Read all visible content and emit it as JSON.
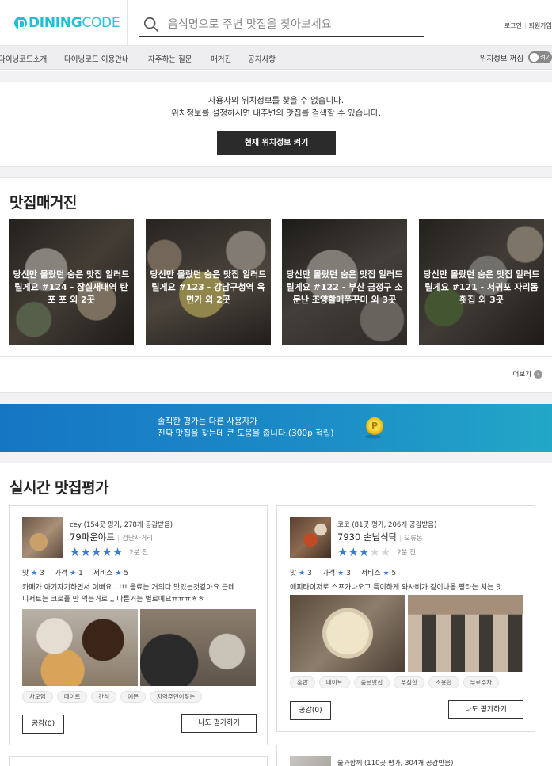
{
  "header": {
    "logo_main": "DINING",
    "logo_thin": "CODE",
    "search_placeholder": "음식명으로 주변 맛집을 찾아보세요",
    "login": "로그인",
    "signup": "회원가입"
  },
  "nav": {
    "items": [
      "다이닝코드소개",
      "다이닝코드 이용안내",
      "자주하는 질문",
      "매거진",
      "공지사항"
    ],
    "location_label": "위치정보 꺼짐",
    "toggle_label": "켜기"
  },
  "location": {
    "line1": "사용자의 위치정보를 찾을 수 없습니다.",
    "line2": "위치정보를 설정하시면 내주변의 맛집를 검색할 수 있습니다.",
    "button": "현재 위치정보 켜기"
  },
  "magazine": {
    "title": "맛집매거진",
    "cards": [
      {
        "title": "당신만 몰랐던 숨은 맛집 알러드릴게요 #124 - 잠실새내역 탄포 포 외 2곳"
      },
      {
        "title": "당신만 몰랐던 숨은 맛집 알러드릴게요 #123 - 강남구청역 옥면가 외 2곳"
      },
      {
        "title": "당신만 몰랐던 숨은 맛집 알러드릴게요 #122 - 부산 금정구 소문난 조양할매쭈꾸미 외 3곳"
      },
      {
        "title": "당신만 몰랐던 숨은 맛집 알러드릴게요 #121 - 서귀포 자리돔횟집 외 3곳"
      }
    ],
    "more": "더보기"
  },
  "banner": {
    "line1": "솔직한 평가는 다른 사용자가",
    "line2": "진짜 맛집을 찾는데 큰 도움을 줍니다.(300p 적립)",
    "coin_letter": "P"
  },
  "reviews": {
    "title": "실시간 맛집평가",
    "items": [
      {
        "user": "cey (154곳 평가, 278개 공감받음)",
        "place": "79파운야드",
        "area": "검단사거리",
        "rating": 5,
        "time": "2분 전",
        "scores": {
          "taste": "맛",
          "taste_v": "3",
          "price": "가격",
          "price_v": "1",
          "service": "서비스",
          "service_v": "5"
        },
        "text1": "카페가 아기자기하면서 이뻐요...!!! 음료는 거의다 맛있는것같아요 근데",
        "text2": "디저트는 크로플 만 먹는거로 ,, 다른거는 별로에요ㅠㅠㅠㅎㅎ",
        "tags": [
          "차모임",
          "데이트",
          "간식",
          "예쁜",
          "지역주민이찾는"
        ],
        "like": "공감(0)",
        "rate": "나도 평가하기"
      },
      {
        "user": "코코 (81곳 평가, 206개 공감받음)",
        "place": "7930 손님식탁",
        "area": "오류동",
        "rating": 3,
        "time": "2분 전",
        "scores": {
          "taste": "맛",
          "taste_v": "3",
          "price": "가격",
          "price_v": "3",
          "service": "서비스",
          "service_v": "5"
        },
        "text1": "애피타이저로 스프가나오고 특이하게 와사비가 같이나옴.평타는 치는 맛",
        "text2": "",
        "tags": [
          "혼밥",
          "데이트",
          "숨은맛집",
          "푸짐한",
          "조용한",
          "무료주차"
        ],
        "like": "공감(0)",
        "rate": "나도 평가하기"
      },
      {
        "user": "술과함께 (110곳 평가, 304개 공감받음)"
      }
    ]
  },
  "colors": {
    "brand": "#1fbfd6",
    "star": "#3a7bd5",
    "banner_start": "#1676c4",
    "banner_end": "#22a7c7",
    "coin": "#f5c51b"
  }
}
